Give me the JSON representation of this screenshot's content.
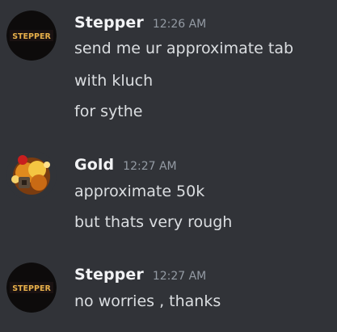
{
  "colors": {
    "background": "#313338",
    "author": "#f2f3f5",
    "text": "#dbdee1",
    "timestamp": "#949ba4"
  },
  "messages": [
    {
      "author": "Stepper",
      "timestamp": "12:26 AM",
      "avatar_text": "STEPPER",
      "lines": [
        "send me ur approximate tab",
        "with kluch",
        "for sythe"
      ]
    },
    {
      "author": "Gold",
      "timestamp": "12:27 AM",
      "lines": [
        "approximate 50k",
        "but thats very rough"
      ]
    },
    {
      "author": "Stepper",
      "timestamp": "12:27 AM",
      "avatar_text": "STEPPER",
      "lines": [
        "no worries , thanks"
      ]
    }
  ]
}
